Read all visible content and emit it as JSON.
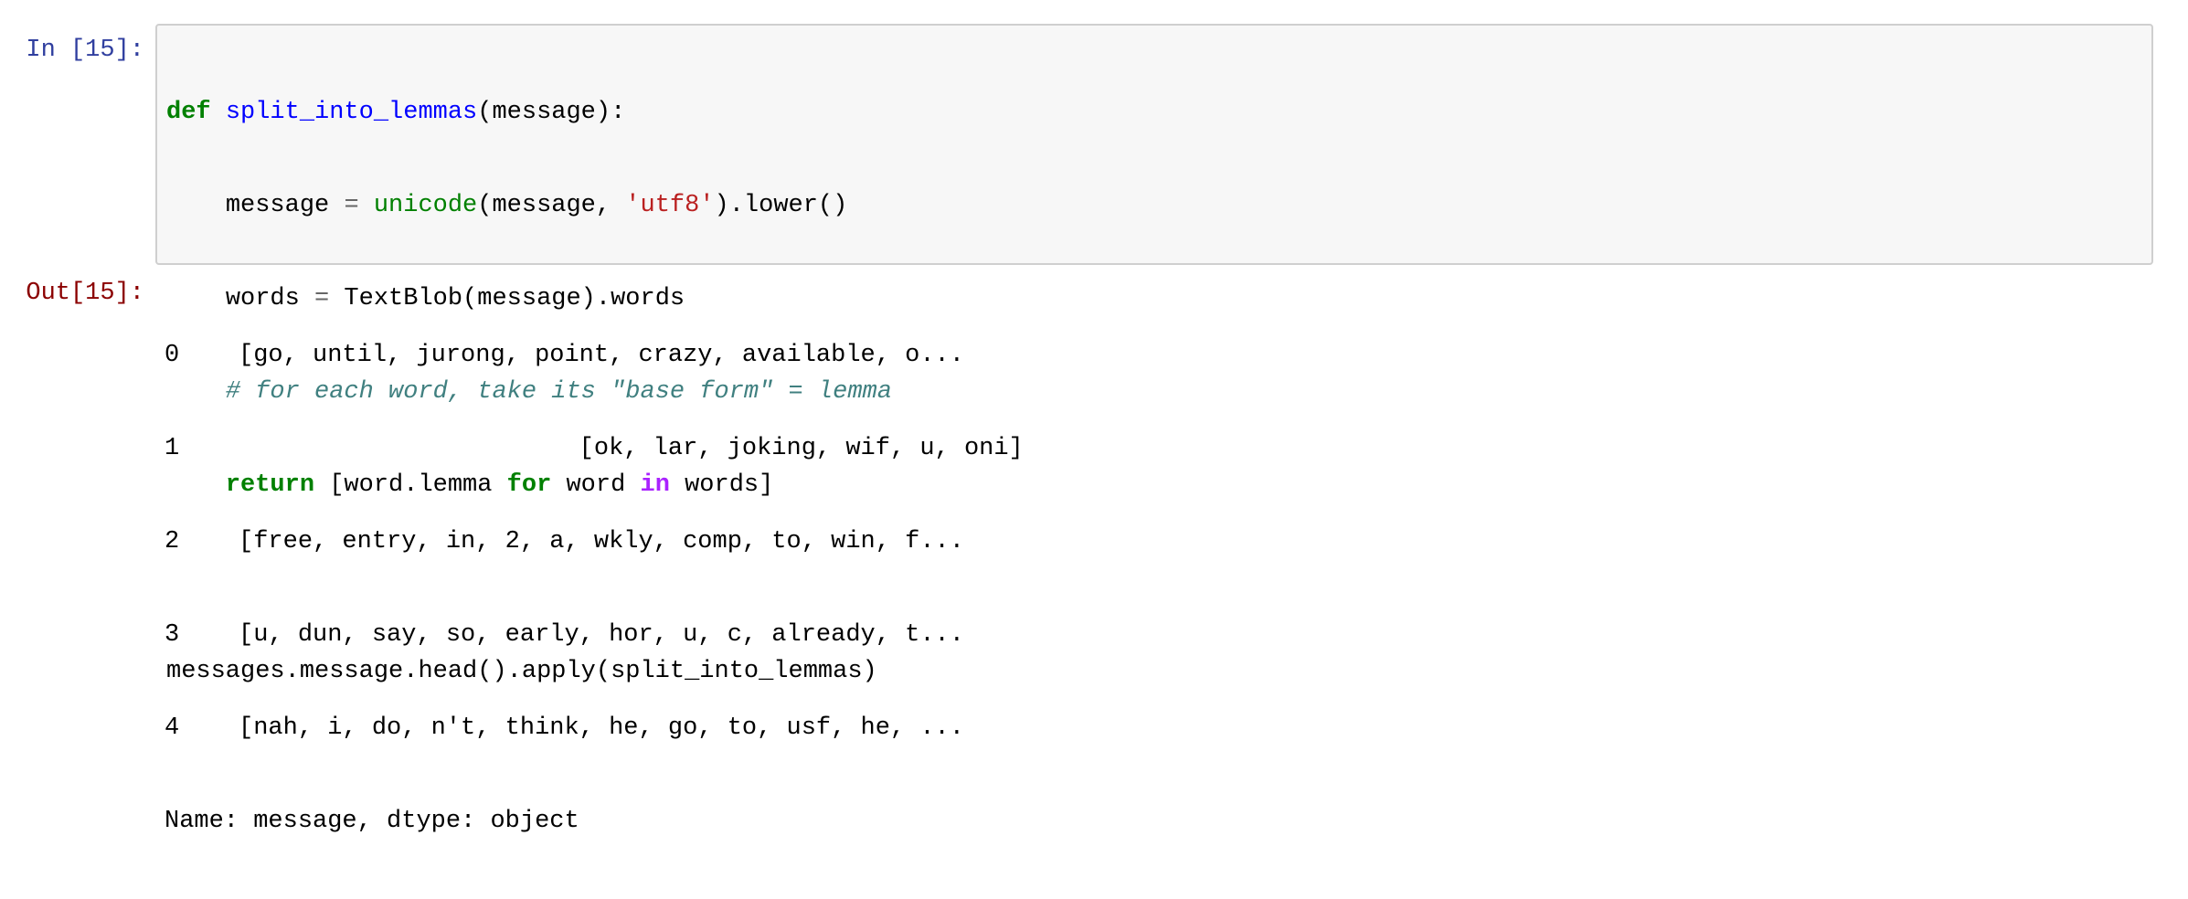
{
  "input_cell": {
    "prompt": "In [15]:",
    "code": {
      "line1": {
        "kw": "def",
        "sp": " ",
        "fname": "split_into_lemmas",
        "rest": "(message):"
      },
      "line2": {
        "indent": "    ",
        "a": "message ",
        "op": "=",
        "sp": " ",
        "builtin": "unicode",
        "b": "(message, ",
        "str": "'utf8'",
        "c": ").lower()"
      },
      "line3": {
        "indent": "    ",
        "a": "words ",
        "op": "=",
        "b": " TextBlob(message).words"
      },
      "line4": {
        "indent": "    ",
        "comment": "# for each word, take its \"base form\" = lemma"
      },
      "line5": {
        "indent": "    ",
        "kw1": "return",
        "a": " [word.lemma ",
        "kw2": "for",
        "b": " word ",
        "kw3": "in",
        "c": " words]"
      },
      "line6": "",
      "line7": "messages.message.head().apply(split_into_lemmas)"
    }
  },
  "output_cell": {
    "prompt": "Out[15]:",
    "lines": [
      "0    [go, until, jurong, point, crazy, available, o...",
      "1                           [ok, lar, joking, wif, u, oni]",
      "2    [free, entry, in, 2, a, wkly, comp, to, win, f...",
      "3    [u, dun, say, so, early, hor, u, c, already, t...",
      "4    [nah, i, do, n't, think, he, go, to, usf, he, ...",
      "Name: message, dtype: object"
    ]
  },
  "colors": {
    "in_prompt": "#303f9f",
    "out_prompt": "#8b0000",
    "keyword": "#008000",
    "function_name": "#0000ff",
    "string": "#ba2121",
    "comment": "#408080",
    "operator_word": "#aa22ff",
    "cell_background": "#f7f7f7",
    "cell_border": "#cfcfcf"
  }
}
